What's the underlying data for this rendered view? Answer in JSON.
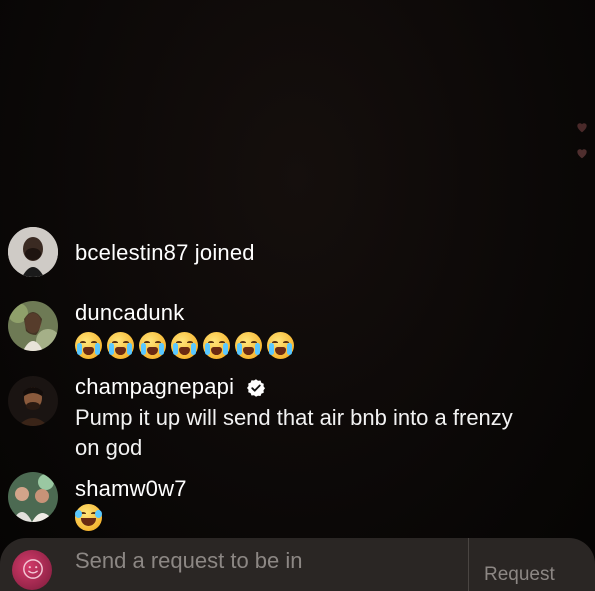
{
  "comments": [
    {
      "username": "bcelestin87 joined",
      "text": "",
      "avatar": "avatar-man-beard"
    },
    {
      "username": "duncadunk",
      "text": "",
      "emoji": [
        "loudly-crying-face",
        "loudly-crying-face",
        "loudly-crying-face",
        "loudly-crying-face",
        "loudly-crying-face",
        "loudly-crying-face",
        "loudly-crying-face"
      ],
      "avatar": "avatar-woman-greenery"
    },
    {
      "username": "champagnepapi",
      "verified": true,
      "text_line1": "Pump it up will send that air bnb into a frenzy",
      "text_line2": "on god",
      "avatar": "avatar-man-dark"
    },
    {
      "username": "shamw0w7",
      "text": "",
      "emoji": [
        "face-with-tears-of-joy"
      ],
      "avatar": "avatar-group-photo"
    }
  ],
  "bottom_bar": {
    "placeholder": "Send a request to be in",
    "request_label": "Request"
  },
  "colors": {
    "background": "#0b0807",
    "bar": "#2a2624",
    "muted_text": "#8c8784",
    "verified": "#ffffff"
  }
}
